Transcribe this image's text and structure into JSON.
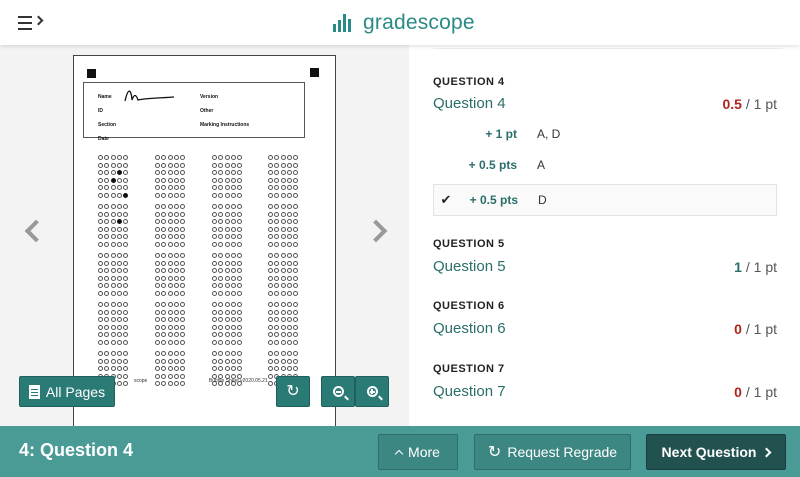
{
  "app": {
    "name": "gradescope"
  },
  "viewer": {
    "sheet_footer": "scope",
    "sheet_version": "Bubble Sheet v2020.05.21",
    "labels": {
      "name": "Name",
      "version": "Version",
      "id": "ID",
      "other": "Other",
      "section": "Section",
      "marking": "Marking Instructions",
      "date": "Date"
    },
    "all_pages_label": "All Pages"
  },
  "questions": [
    {
      "header": "QUESTION 4",
      "title": "Question 4",
      "score": "0.5",
      "max": "/ 1 pt",
      "rubric": [
        {
          "pts": "+ 1 pt",
          "desc": "A, D",
          "selected": false
        },
        {
          "pts": "+ 0.5 pts",
          "desc": "A",
          "selected": false
        },
        {
          "pts": "+ 0.5 pts",
          "desc": "D",
          "selected": true
        }
      ]
    },
    {
      "header": "QUESTION 5",
      "title": "Question 5",
      "score": "1",
      "max": "/ 1 pt"
    },
    {
      "header": "QUESTION 6",
      "title": "Question 6",
      "score": "0",
      "max": "/ 1 pt"
    },
    {
      "header": "QUESTION 7",
      "title": "Question 7",
      "score": "0",
      "max": "/ 1 pt"
    }
  ],
  "bottom": {
    "question_label": "4: Question 4",
    "more_label": "More",
    "regrade_label": "Request Regrade",
    "next_label": "Next Question"
  },
  "colors": {
    "accent": "#2a8a85",
    "bar": "#4a9a95",
    "score_red": "#b0241c"
  }
}
